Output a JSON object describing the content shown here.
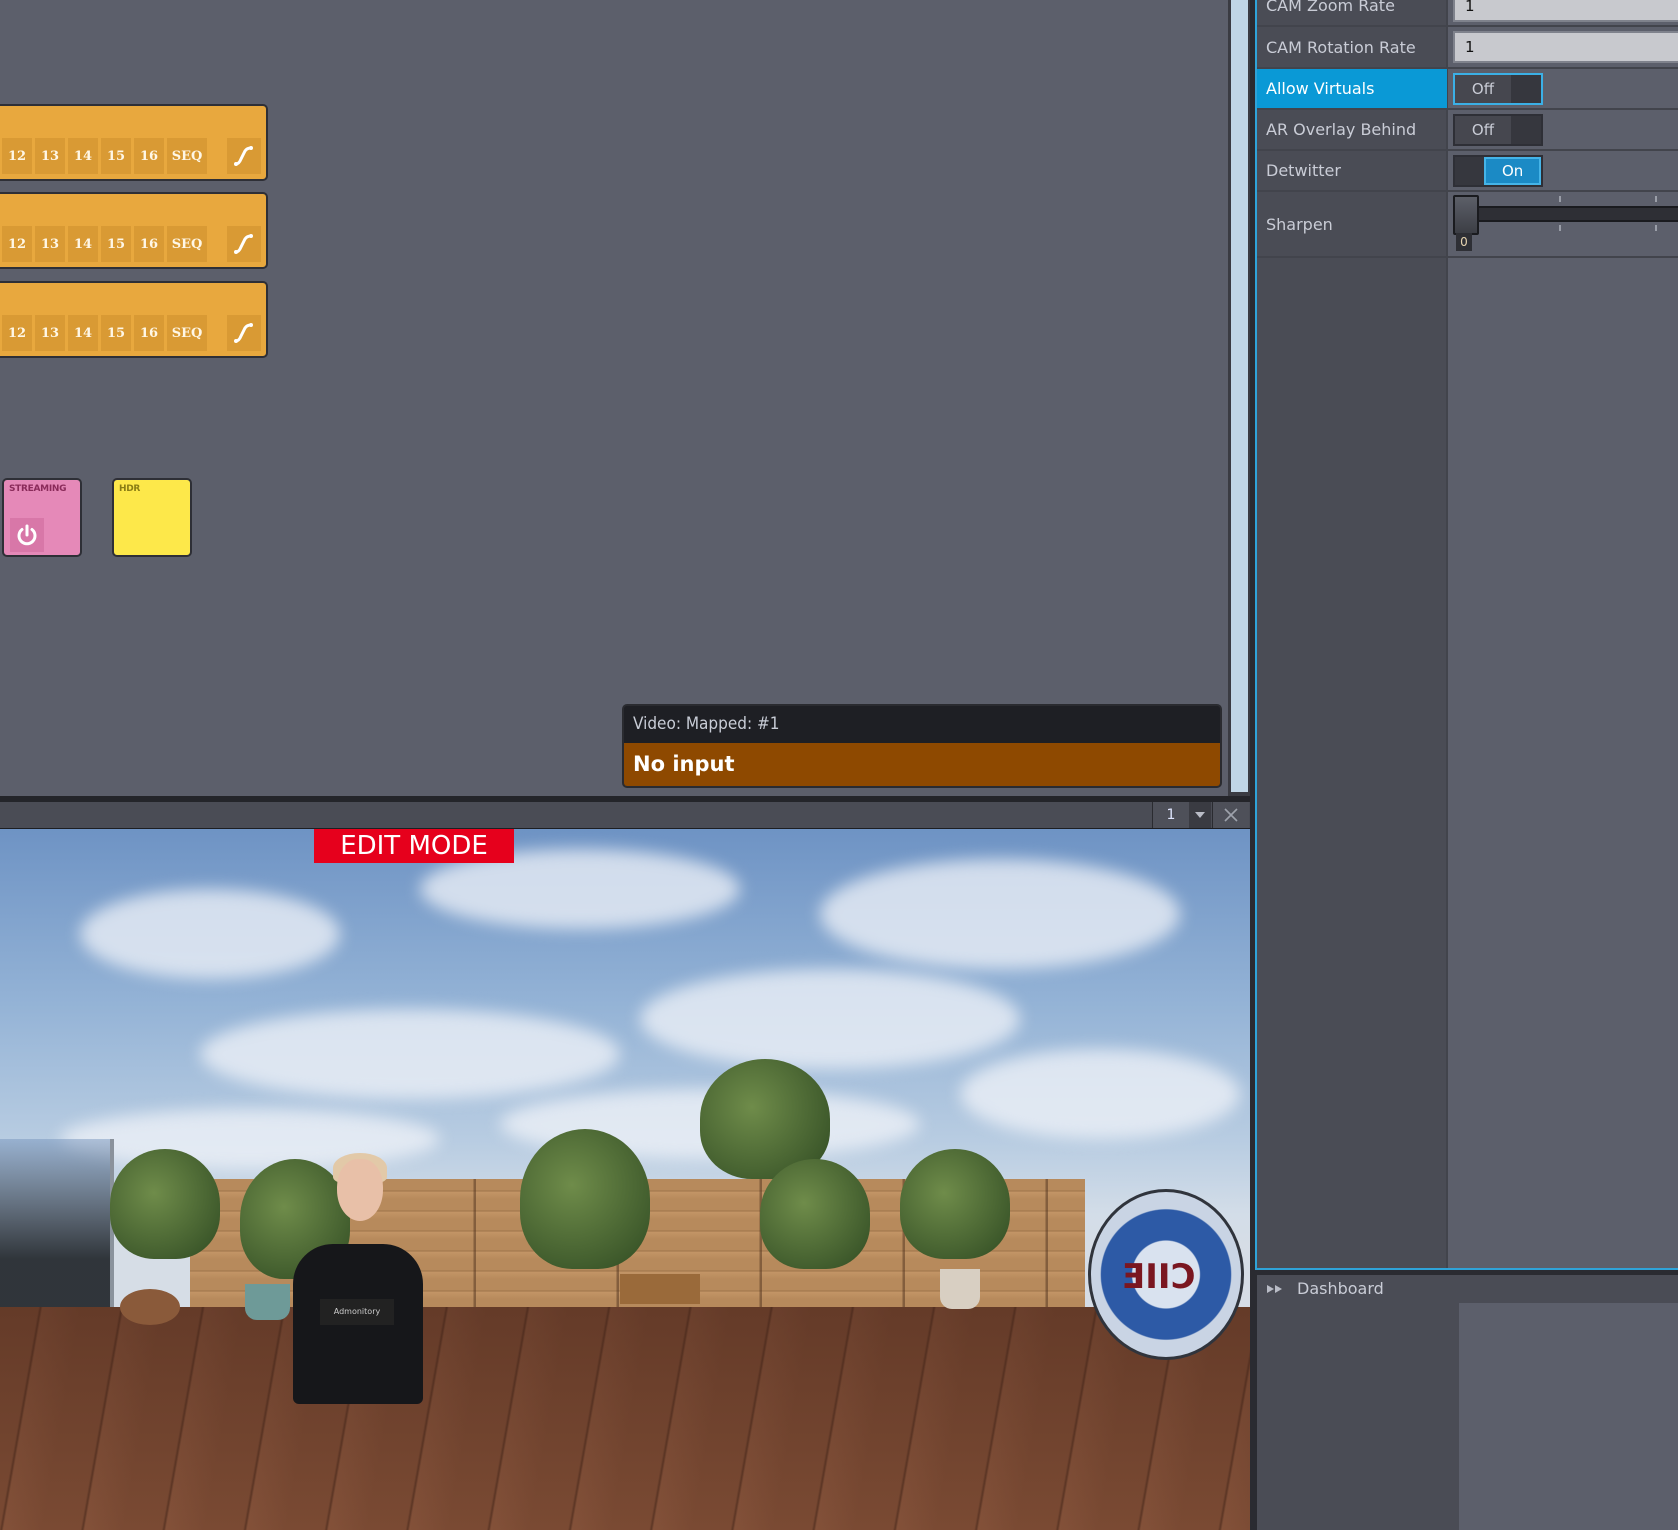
{
  "workspace": {
    "sequencer_rows": [
      {
        "buttons": [
          "12",
          "13",
          "14",
          "15",
          "16",
          "SEQ"
        ],
        "curve_icon": "transition-curve-icon"
      },
      {
        "buttons": [
          "12",
          "13",
          "14",
          "15",
          "16",
          "SEQ"
        ],
        "curve_icon": "transition-curve-icon"
      },
      {
        "buttons": [
          "12",
          "13",
          "14",
          "15",
          "16",
          "SEQ"
        ],
        "curve_icon": "transition-curve-icon"
      }
    ],
    "tiles": {
      "streaming": {
        "label": "STREAMING",
        "icon": "power-icon",
        "color": "#e589b8"
      },
      "hdr": {
        "label": "HDR",
        "color": "#fde84a"
      }
    },
    "video_info": {
      "title": "Video: Mapped: #1",
      "status": "No input",
      "status_color": "#8e4900"
    }
  },
  "video_panel": {
    "output_number": "1",
    "dropdown_icon": "chevron-down-icon",
    "close_icon": "close-icon",
    "edit_mode_label": "EDIT MODE",
    "presenter_card_text": "Admonitory",
    "logo_text": "CIIE"
  },
  "properties": {
    "rows": [
      {
        "label": "CAM Zoom Rate",
        "type": "input",
        "value": "1"
      },
      {
        "label": "CAM Rotation Rate",
        "type": "input",
        "value": "1"
      },
      {
        "label": "Allow Virtuals",
        "type": "toggle",
        "value": "Off",
        "selected": true
      },
      {
        "label": "AR Overlay Behind",
        "type": "toggle",
        "value": "Off"
      },
      {
        "label": "Detwitter",
        "type": "toggle",
        "value": "On"
      },
      {
        "label": "Sharpen",
        "type": "slider",
        "value": "0"
      }
    ],
    "accent_color": "#0a99d6"
  },
  "dashboard": {
    "label": "Dashboard",
    "expand_icon": "double-chevron-right-icon"
  }
}
